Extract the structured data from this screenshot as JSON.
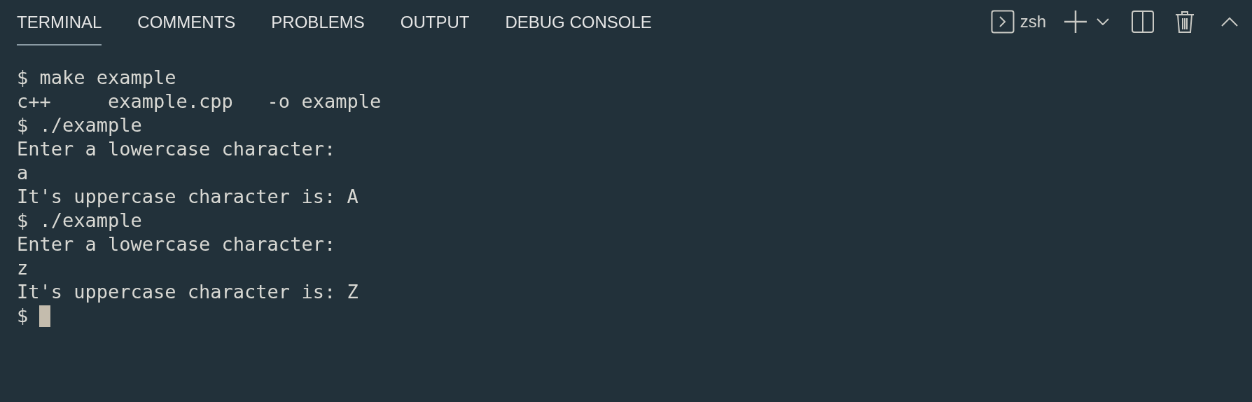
{
  "tabs": [
    {
      "label": "TERMINAL",
      "selected": true
    },
    {
      "label": "COMMENTS",
      "selected": false
    },
    {
      "label": "PROBLEMS",
      "selected": false
    },
    {
      "label": "OUTPUT",
      "selected": false
    },
    {
      "label": "DEBUG CONSOLE",
      "selected": false
    }
  ],
  "toolbar": {
    "shell": "zsh"
  },
  "terminal": {
    "lines": [
      "$ make example",
      "c++     example.cpp   -o example",
      "$ ./example",
      "Enter a lowercase character:",
      "a",
      "It's uppercase character is: A",
      "$ ./example",
      "Enter a lowercase character:",
      "z",
      "It's uppercase character is: Z"
    ],
    "prompt": {
      "text": "$",
      "cursor": true
    }
  }
}
